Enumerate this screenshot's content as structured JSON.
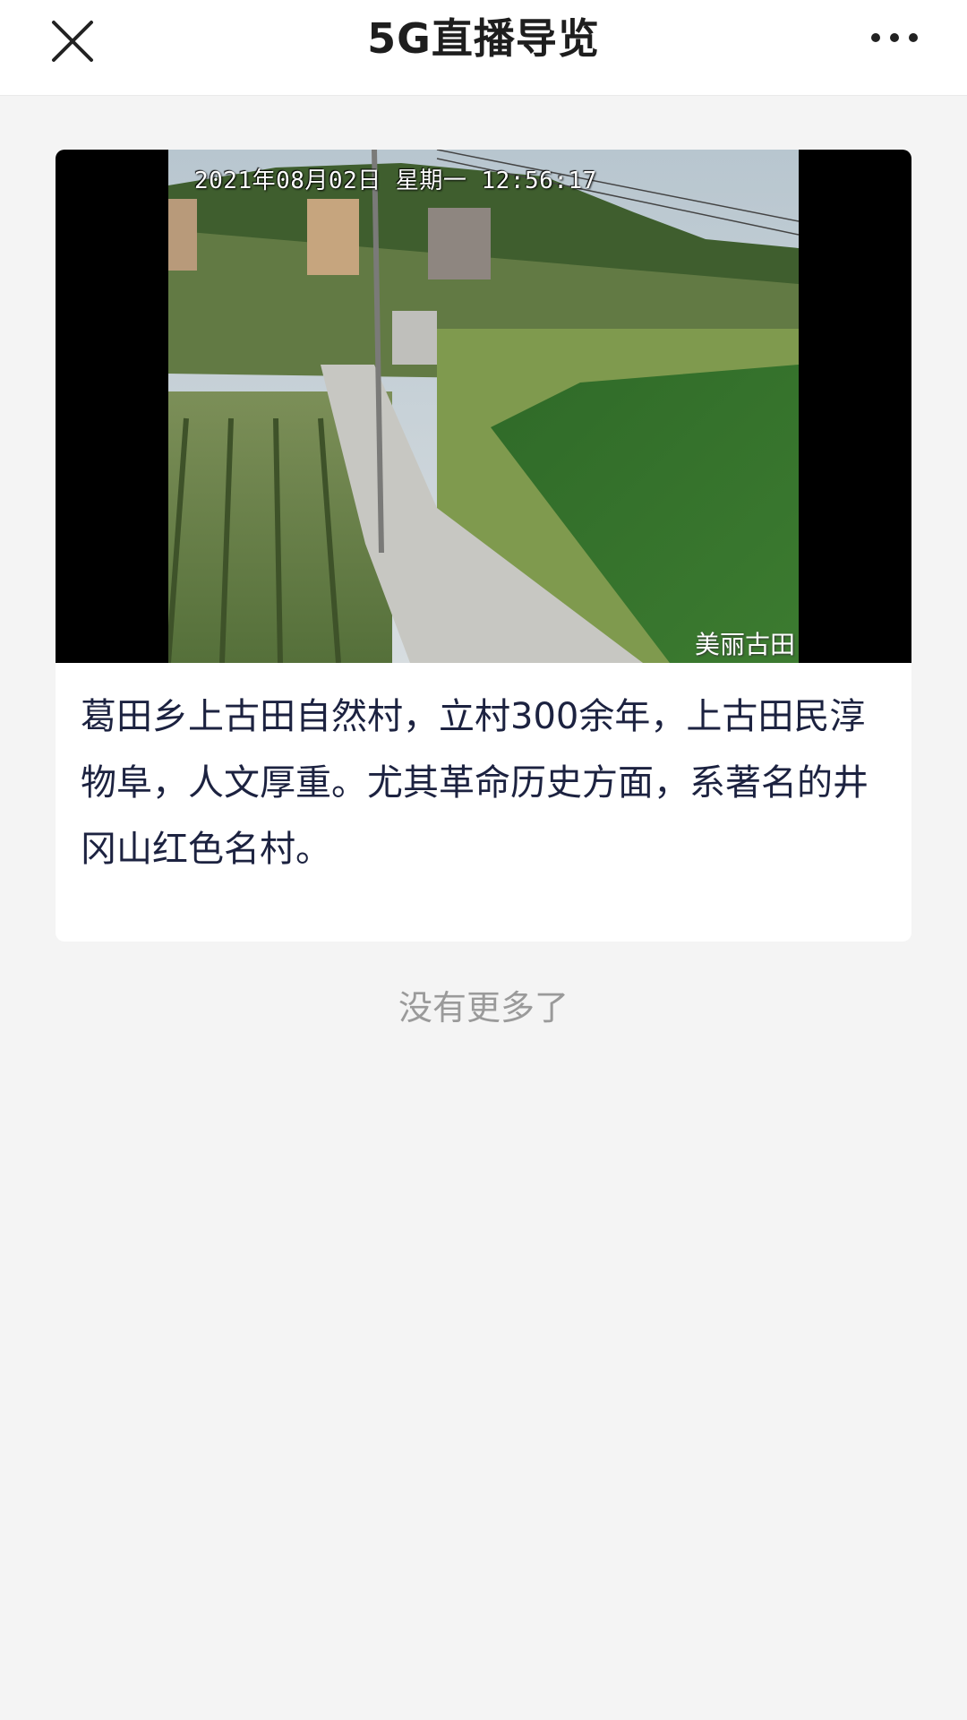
{
  "nav": {
    "title": "5G直播导览",
    "close_icon": "close-icon",
    "more_icon": "more-dots-icon"
  },
  "video": {
    "timestamp": "2021年08月02日  星期一  12:56:17",
    "watermark": "美丽古田"
  },
  "description": "葛田乡上古田自然村，立村300余年，上古田民淳物阜，人文厚重。尤其革命历史方面，系著名的井冈山红色名村。",
  "footer": {
    "no_more": "没有更多了"
  },
  "colors": {
    "background": "#f4f4f4",
    "nav_bg": "#ffffff",
    "text_primary": "#1c2240",
    "text_muted": "#9a9a9a"
  }
}
